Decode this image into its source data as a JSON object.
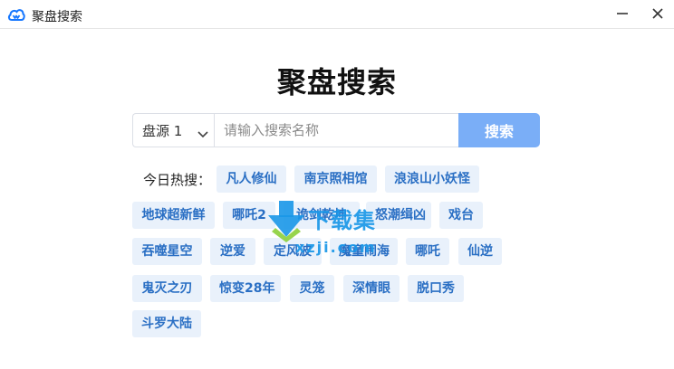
{
  "window": {
    "title": "聚盘搜索",
    "icons": {
      "app": "cloud-drive-icon",
      "minimize": "minimize-icon",
      "close": "close-icon"
    },
    "min_glyph": "—",
    "close_glyph": "✕"
  },
  "main": {
    "title": "聚盘搜索"
  },
  "search": {
    "source_value": "盘源 1",
    "placeholder": "请输入搜索名称",
    "value": "",
    "button_label": "搜索",
    "accent_color": "#7aaef7"
  },
  "hot": {
    "label": "今日热搜：",
    "tags": [
      "凡人修仙",
      "南京照相馆",
      "浪浪山小妖怪",
      "地球超新鲜",
      "哪吒2",
      "诡剑乾坤",
      "怒潮缉凶",
      "戏台",
      "吞噬星空",
      "逆爱",
      "定风波",
      "魔童闹海",
      "哪吒",
      "仙逆",
      "鬼灭之刃",
      "惊变28年",
      "灵笼",
      "深情眼",
      "脱口秀",
      "斗罗大陆"
    ],
    "tag_bg": "#e9f1fb",
    "tag_text_color": "#2a6fc4"
  },
  "watermark": {
    "text": "下载集",
    "url": "xzji.com"
  }
}
